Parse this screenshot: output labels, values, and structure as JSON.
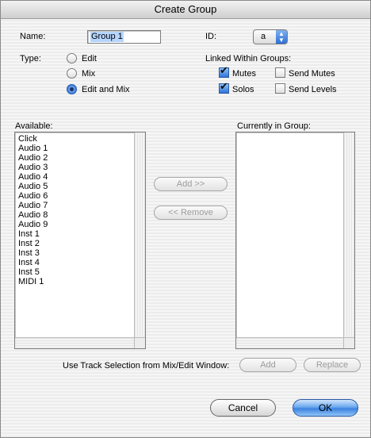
{
  "window": {
    "title": "Create Group"
  },
  "name": {
    "label": "Name:",
    "value": "Group 1"
  },
  "id": {
    "label": "ID:",
    "value": "a"
  },
  "type": {
    "label": "Type:",
    "options": [
      "Edit",
      "Mix",
      "Edit and Mix"
    ],
    "selected": "Edit and Mix"
  },
  "linked": {
    "label": "Linked Within Groups:",
    "mutes": {
      "label": "Mutes",
      "checked": true
    },
    "send_mutes": {
      "label": "Send Mutes",
      "checked": false
    },
    "solos": {
      "label": "Solos",
      "checked": true
    },
    "send_levels": {
      "label": "Send Levels",
      "checked": false
    }
  },
  "available": {
    "label": "Available:",
    "items": [
      "Click",
      "Audio 1",
      "Audio 2",
      "Audio 3",
      "Audio 4",
      "Audio 5",
      "Audio 6",
      "Audio 7",
      "Audio 8",
      "Audio 9",
      "Inst 1",
      "Inst 2",
      "Inst 3",
      "Inst 4",
      "Inst 5",
      "MIDI 1"
    ]
  },
  "current": {
    "label": "Currently in Group:",
    "items": []
  },
  "buttons": {
    "add": "Add >>",
    "remove": "<< Remove",
    "use_track_label": "Use Track Selection from Mix/Edit Window:",
    "sel_add": "Add",
    "sel_replace": "Replace",
    "cancel": "Cancel",
    "ok": "OK"
  }
}
